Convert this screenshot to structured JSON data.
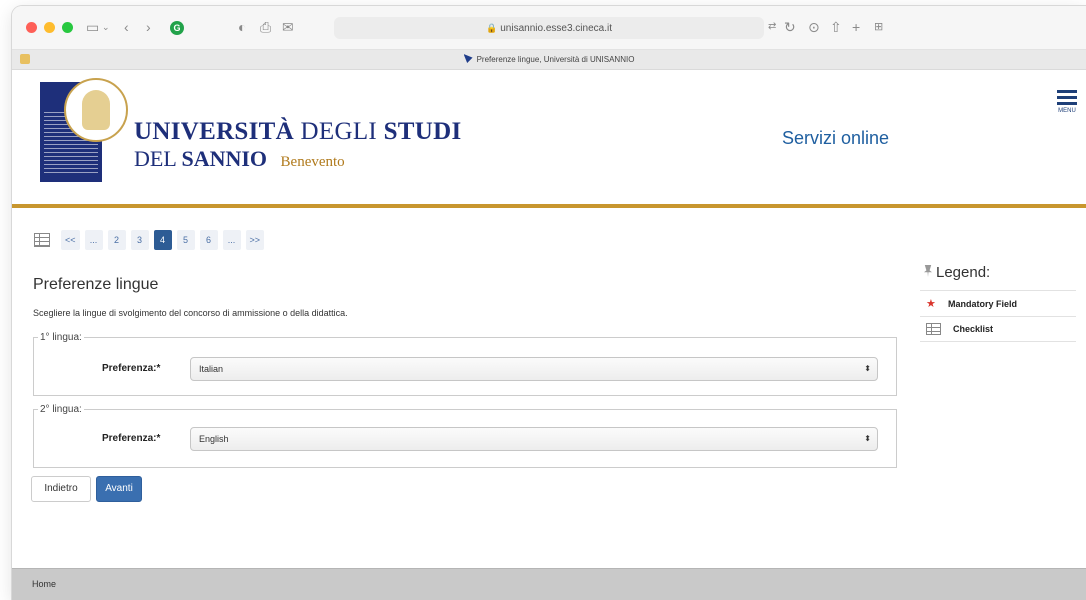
{
  "browser": {
    "url": "unisannio.esse3.cineca.it",
    "tab_title": "Preferenze lingue, Università di UNISANNIO"
  },
  "header": {
    "uni_line1_a": "UNIVERSITÀ",
    "uni_line1_b": "DEGLI",
    "uni_line1_c": "STUDI",
    "uni_line2_a": "DEL",
    "uni_line2_b": "SANNIO",
    "uni_city": "Benevento",
    "services_link": "Servizi online",
    "menu_label": "MENU"
  },
  "pager": {
    "pages": [
      "<<",
      "...",
      "2",
      "3",
      "4",
      "5",
      "6",
      "...",
      ">>"
    ],
    "current": "4"
  },
  "main": {
    "title": "Preferenze lingue",
    "intro": "Scegliere la lingue di svolgimento del concorso di ammissione o della didattica.",
    "lang1": {
      "legend": "1° lingua:",
      "label": "Preferenza:*",
      "value": "Italian"
    },
    "lang2": {
      "legend": "2° lingua:",
      "label": "Preferenza:*",
      "value": "English"
    },
    "back_label": "Indietro",
    "next_label": "Avanti"
  },
  "legend": {
    "title": "Legend:",
    "items": [
      "Mandatory Field",
      "Checklist"
    ]
  },
  "footer": {
    "home": "Home"
  },
  "colors": {
    "brand_blue": "#1e2f7a",
    "gold_accent": "#c8962e",
    "primary_button": "#3a6fb0",
    "mandatory_star": "#d9342b"
  },
  "icons": [
    "sidebar-icon",
    "back-icon",
    "forward-icon",
    "checklist-icon",
    "star-icon",
    "pin-icon",
    "menu-icon"
  ]
}
